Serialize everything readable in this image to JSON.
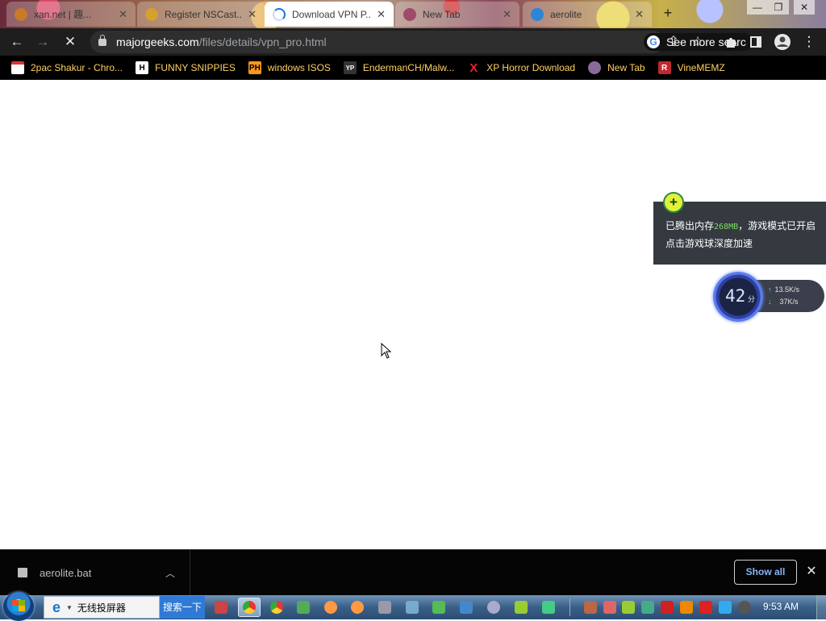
{
  "tabs": [
    {
      "title": "xan.net | 趣...",
      "favicon_color": "#c87a2a",
      "state": "background"
    },
    {
      "title": "Register NSCast...",
      "favicon_color": "#d4a030",
      "state": "background"
    },
    {
      "title": "Download VPN P...",
      "favicon_color": "#1a73e8",
      "state": "active"
    },
    {
      "title": "New Tab",
      "favicon_color": "#a04a6a",
      "state": "background"
    },
    {
      "title": "aerolite",
      "favicon_color": "#2a86d8",
      "state": "background"
    }
  ],
  "toolbar": {
    "url_host": "majorgeeks.com",
    "url_path": "/files/details/vpn_pro.html",
    "search_chip": "See more searc"
  },
  "bookmarks": [
    {
      "label": "2pac Shakur - Chro...",
      "icon": "calendar-icon",
      "icon_text": "",
      "icon_color": "#d33"
    },
    {
      "label": "FUNNY SNIPPIES",
      "icon": "h-logo-icon",
      "icon_text": "H",
      "icon_color": "#222"
    },
    {
      "label": "windows ISOS",
      "icon": "ph-logo-icon",
      "icon_text": "PH",
      "icon_color": "#f7971e"
    },
    {
      "label": "EndermanCH/Malw...",
      "icon": "yp-logo-icon",
      "icon_text": "YP",
      "icon_color": "#333"
    },
    {
      "label": "XP Horror Download",
      "icon": "x-logo-icon",
      "icon_text": "X",
      "icon_color": "#000"
    },
    {
      "label": "New Tab",
      "icon": "globe-icon",
      "icon_text": "",
      "icon_color": "#8a6a9a"
    },
    {
      "label": "VineMEMZ",
      "icon": "r-logo-icon",
      "icon_text": "R",
      "icon_color": "#c0282d"
    }
  ],
  "notice": {
    "line1_prefix": "已腾出内存",
    "line1_mb": "268MB",
    "line1_suffix": "，游戏模式已开启",
    "line2": "点击游戏球深度加速"
  },
  "game_ball": {
    "score": "42",
    "unit": "分",
    "upload": "13.5K/s",
    "download": "37K/s"
  },
  "download_shelf": {
    "file_name": "aerolite.bat",
    "show_all": "Show all"
  },
  "taskbar": {
    "search_text": "无线投屏器",
    "search_button": "搜索一下",
    "clock": "9:53 AM",
    "apps": [
      {
        "icon": "app-icon-1",
        "color": "#c44"
      },
      {
        "icon": "chrome-icon",
        "color": "#e33",
        "active": true
      },
      {
        "icon": "chrome-icon-2",
        "color": "#e33"
      },
      {
        "icon": "iqiyi-icon",
        "color": "#5a5"
      },
      {
        "icon": "browser-icon",
        "color": "#f94"
      },
      {
        "icon": "browser-icon-2",
        "color": "#f94"
      },
      {
        "icon": "computer-icon",
        "color": "#99a"
      },
      {
        "icon": "shield-icon",
        "color": "#7ac"
      },
      {
        "icon": "app-icon-2",
        "color": "#5b5"
      },
      {
        "icon": "cursor-icon",
        "color": "#48c"
      },
      {
        "icon": "mouse-icon",
        "color": "#aac"
      },
      {
        "icon": "player-icon",
        "color": "#9c3"
      },
      {
        "icon": "windows-icon",
        "color": "#4c8"
      }
    ],
    "tray": [
      {
        "icon": "tray-icon-1",
        "color": "#b64"
      },
      {
        "icon": "tray-icon-2",
        "color": "#d66"
      },
      {
        "icon": "tray-icon-3",
        "color": "#9c3"
      },
      {
        "icon": "tray-icon-4",
        "color": "#4a8"
      },
      {
        "icon": "tray-icon-5",
        "color": "#c22"
      },
      {
        "icon": "tray-icon-6",
        "color": "#e80"
      },
      {
        "icon": "tray-icon-7",
        "color": "#d22"
      },
      {
        "icon": "tray-icon-8",
        "color": "#3ae"
      },
      {
        "icon": "tray-icon-9",
        "color": "#555"
      }
    ]
  }
}
